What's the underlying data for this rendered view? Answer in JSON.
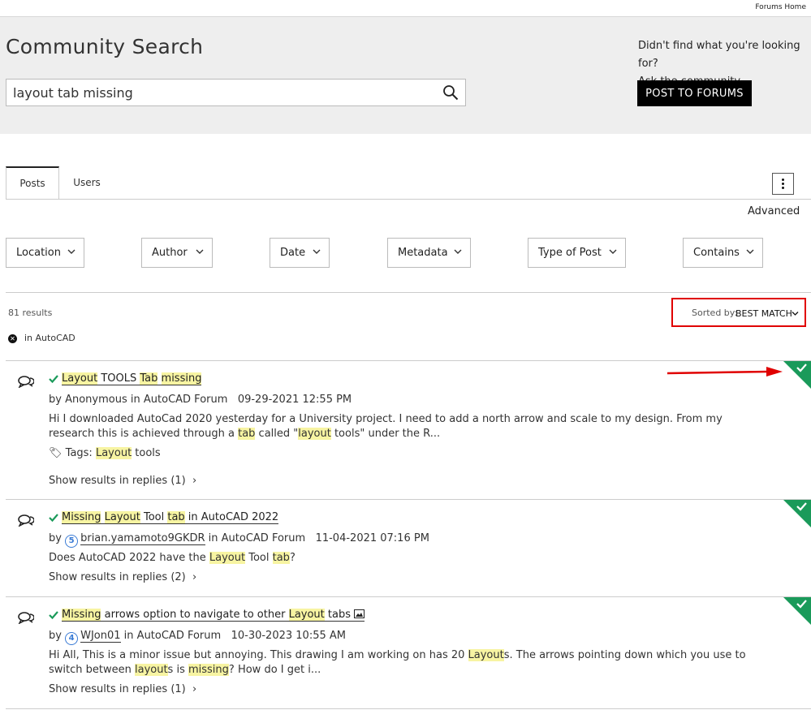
{
  "header": {
    "forums_home": "Forums Home"
  },
  "hero": {
    "title": "Community Search",
    "search_value": "layout tab missing",
    "ask_line1": "Didn't find what you're looking for?",
    "ask_line2": "Ask the community.",
    "post_button": "POST TO FORUMS"
  },
  "tabs": [
    {
      "label": "Posts"
    },
    {
      "label": "Users"
    }
  ],
  "advanced": "Advanced",
  "filters": [
    {
      "label": "Location"
    },
    {
      "label": "Author"
    },
    {
      "label": "Date"
    },
    {
      "label": "Metadata"
    },
    {
      "label": "Type of Post"
    },
    {
      "label": "Contains"
    }
  ],
  "results": {
    "count": "81 results",
    "sorted_by_label": "Sorted by:",
    "sorted_by_value": "BEST MATCH",
    "active_filter": "in AutoCAD"
  },
  "posts": [
    {
      "title_parts": [
        "Layout",
        " TOOLS ",
        "Tab",
        " ",
        "missing"
      ],
      "by": "by",
      "author": "Anonymous",
      "in": "in",
      "board": "AutoCAD Forum",
      "date": "09-29-2021 12:55 PM",
      "snippet_parts": [
        "Hi I downloaded AutoCad 2020 yesterday for a University project. I need to add a north arrow and scale to my design. From my research this is achieved through a ",
        "tab",
        " called \"",
        "layout",
        " tools\" under the R..."
      ],
      "tags_label": "Tags:",
      "tag_parts": [
        "Layout",
        " tools"
      ],
      "show_replies": "Show results in replies (1)"
    },
    {
      "title_parts": [
        "Missing",
        " ",
        "Layout",
        " Tool ",
        "tab",
        " in AutoCAD 2022"
      ],
      "by": "by",
      "author_rank": "5",
      "author": "brian.yamamoto9GKDR",
      "in": "in",
      "board": "AutoCAD Forum",
      "date": "11-04-2021 07:16 PM",
      "snippet_parts": [
        "Does AutoCAD 2022 have the ",
        "Layout",
        " Tool ",
        "tab",
        "?"
      ],
      "show_replies": "Show results in replies (2)"
    },
    {
      "title_parts": [
        "Missing",
        " arrows option to navigate to other ",
        "Layout",
        " tabs"
      ],
      "by": "by",
      "author_rank": "4",
      "author": "WJon01",
      "in": "in",
      "board": "AutoCAD Forum",
      "date": "10-30-2023 10:55 AM",
      "snippet_parts": [
        "Hi All,   This is a minor issue but annoying.   This drawing I am working on has 20 ",
        "Layout",
        "s. The arrows pointing down which you use to switch between ",
        "layout",
        "s is ",
        "missing",
        "? How do I get i..."
      ],
      "show_replies": "Show results in replies (1)"
    }
  ],
  "colors": {
    "accent_green": "#1a9a5a",
    "highlight": "#f7f4a2",
    "annotation_red": "#e00000"
  }
}
